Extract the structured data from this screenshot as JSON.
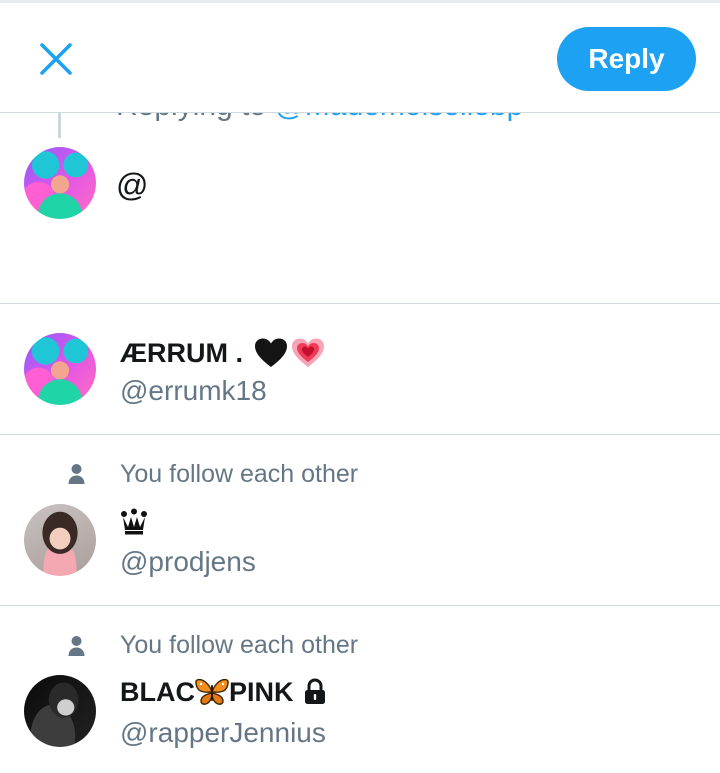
{
  "header": {
    "reply_label": "Reply",
    "close_icon": "close-icon",
    "accent_color": "#1da1f2"
  },
  "reply_context": {
    "prefix": "Replying to ",
    "handle": "@Mademoisellebp"
  },
  "compose": {
    "text": "@"
  },
  "suggestions": [
    {
      "follow_text": "",
      "name_text": "ÆRRUM .",
      "name_icons": [
        "black-heart-icon",
        "growing-heart-icon"
      ],
      "handle": "@errumk18"
    },
    {
      "follow_text": "You follow each other",
      "name_text": "",
      "name_icons": [
        "crown-icon"
      ],
      "handle": "@prodjens"
    },
    {
      "follow_text": "You follow each other",
      "name_text_before": "BLAC",
      "name_text_after": "PINK",
      "name_icons": [
        "butterfly-icon",
        "lock-icon"
      ],
      "handle": "@rapperJennius"
    }
  ]
}
